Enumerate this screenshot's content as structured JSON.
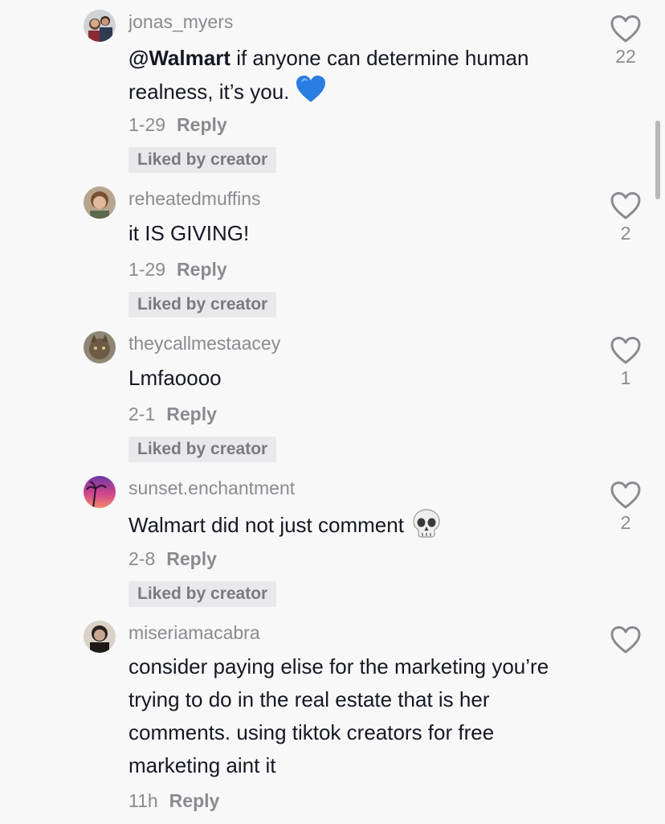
{
  "comments": [
    {
      "username": "jonas_myers",
      "mention": "@Walmart",
      "text": " if anyone can determine human realness, it’s you.",
      "emoji": "blue-heart-emoji",
      "date": "1-29",
      "reply": "Reply",
      "badge": "Liked by creator",
      "likes": "22"
    },
    {
      "username": "reheatedmuffins",
      "text": "it IS GIVING!",
      "date": "1-29",
      "reply": "Reply",
      "badge": "Liked by creator",
      "likes": "2"
    },
    {
      "username": "theycallmestaacey",
      "text": "Lmfaoooo",
      "date": "2-1",
      "reply": "Reply",
      "badge": "Liked by creator",
      "likes": "1"
    },
    {
      "username": "sunset.enchantment",
      "text": "Walmart did not just comment",
      "emoji": "skull-emoji",
      "date": "2-8",
      "reply": "Reply",
      "badge": "Liked by creator",
      "likes": "2"
    },
    {
      "username": "miseriamacabra",
      "text": "consider paying elise for the marketing you’re trying to do in the real estate that is her comments. using tiktok creators for free marketing aint it",
      "date": "11h",
      "reply": "Reply",
      "likes": ""
    }
  ],
  "colors": {
    "background": "#f8f8f8",
    "text": "#161823",
    "secondary": "#8a8b91",
    "badge_bg": "#e9e9eb"
  },
  "icons": [
    "heart-outline-icon",
    "blue-heart-emoji",
    "skull-emoji"
  ]
}
